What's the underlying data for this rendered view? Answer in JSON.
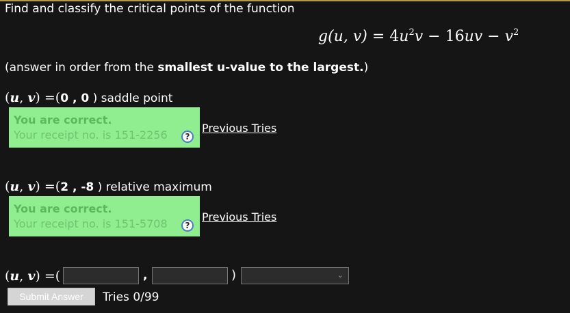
{
  "question": {
    "intro": "Find and classify the critical points of the function",
    "formula": {
      "lhs_func": "g",
      "lhs_args": "(u, v)",
      "equals": " = ",
      "term1_coef": "4",
      "term1_var1": "u",
      "term1_exp": "2",
      "term1_var2": "v",
      "minus1": " − ",
      "term2_coef": "16",
      "term2_vars": "uv",
      "minus2": " − ",
      "term3_var": "v",
      "term3_exp": "2"
    },
    "instruction_prefix": "(answer in order from the ",
    "instruction_bold": "smallest u-value to the largest.",
    "instruction_suffix": ")"
  },
  "point_label": {
    "open": "(",
    "u": "u",
    "sep": ", ",
    "v": "v",
    "close": ")",
    "equals_paren": " =("
  },
  "answers": [
    {
      "u": "0",
      "sep": " , ",
      "v": "0",
      "close": " )",
      "classification": " saddle point",
      "feedback_title": "You are correct.",
      "receipt": "Your receipt no. is 151-2256",
      "previous_tries": "Previous Tries"
    },
    {
      "u": "2",
      "sep": " , ",
      "v": "-8",
      "close": " )",
      "classification": " relative maximum",
      "feedback_title": "You are correct.",
      "receipt": "Your receipt no. is 151-5708",
      "previous_tries": "Previous Tries"
    }
  ],
  "entry": {
    "comma": ",",
    "close": ")",
    "u_value": "",
    "v_value": "",
    "classification_selected": ""
  },
  "help_icon": "?",
  "select_chevron": "⌄",
  "submit_label": "Submit Answer",
  "tries": "Tries 0/99",
  "colors": {
    "background": "#151515",
    "correct_bg": "#90ee90",
    "correct_text": "#5bb85b",
    "accent_line": "#b59b52"
  }
}
